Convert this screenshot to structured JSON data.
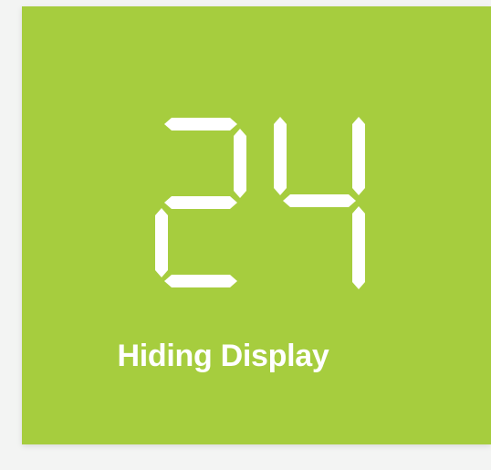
{
  "display": {
    "digits": [
      "2",
      "4"
    ],
    "segment_color": "#ffffff",
    "background_color": "#a6cd3e"
  },
  "caption": "Hiding Display"
}
